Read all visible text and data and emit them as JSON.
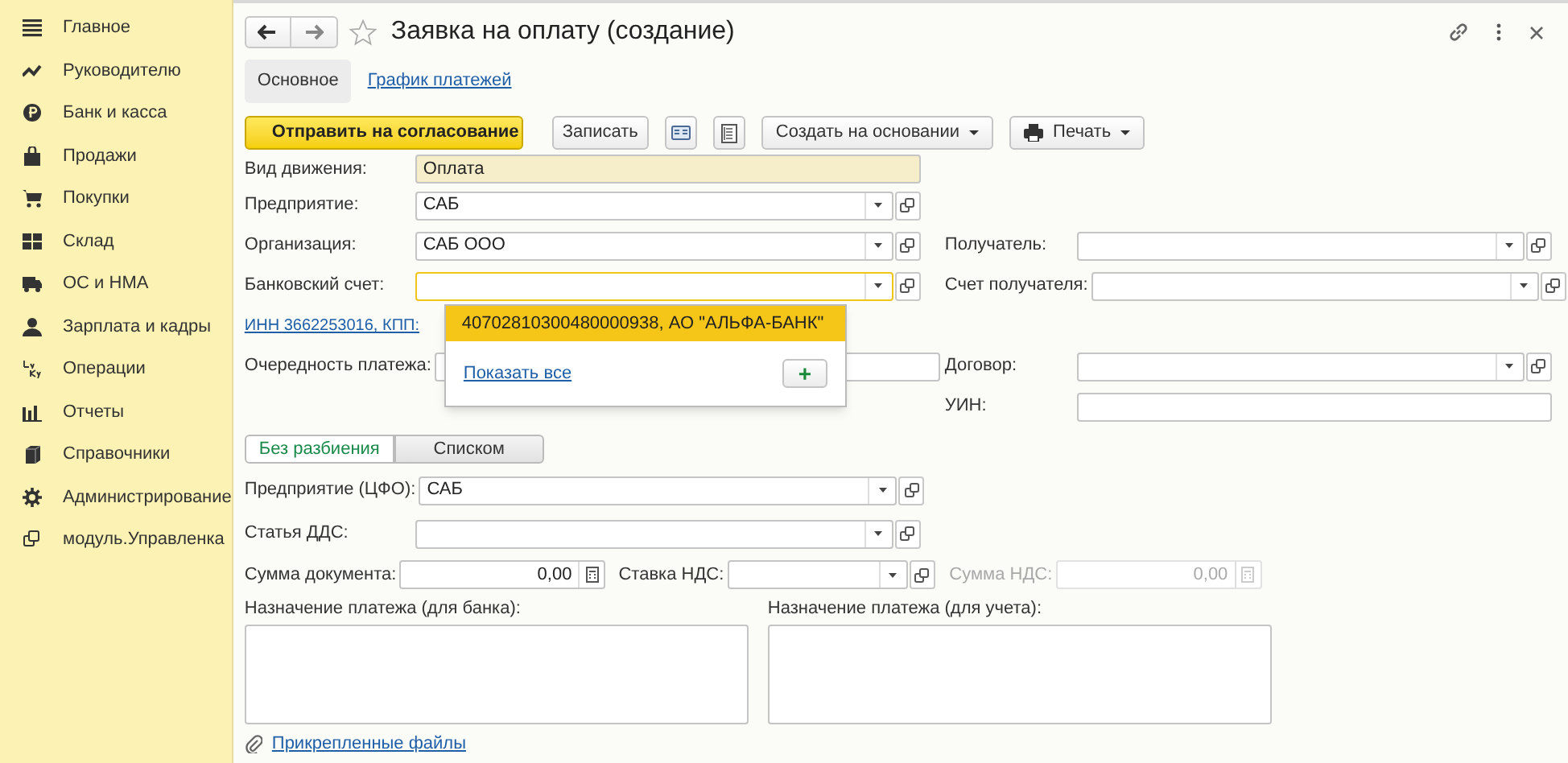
{
  "sidebar": {
    "items": [
      {
        "label": "Главное"
      },
      {
        "label": "Руководителю"
      },
      {
        "label": "Банк и касса"
      },
      {
        "label": "Продажи"
      },
      {
        "label": "Покупки"
      },
      {
        "label": "Склад"
      },
      {
        "label": "ОС и НМА"
      },
      {
        "label": "Зарплата и кадры"
      },
      {
        "label": "Операции"
      },
      {
        "label": "Отчеты"
      },
      {
        "label": "Справочники"
      },
      {
        "label": "Администрирование"
      },
      {
        "label": "модуль.Управленка"
      }
    ]
  },
  "window": {
    "title": "Заявка на оплату (создание)"
  },
  "tabs": [
    {
      "label": "Основное",
      "selected": true
    },
    {
      "label": "График платежей",
      "selected": false
    }
  ],
  "toolbar": {
    "primary": "Отправить на согласование",
    "buttons": [
      {
        "label": "Записать",
        "dropdown": false
      },
      {
        "label": "Создать на основании",
        "dropdown": true
      },
      {
        "label": "Печать",
        "dropdown": true
      }
    ]
  },
  "header_rows": [
    {
      "left": {
        "kind": "field",
        "label": "Вид движения:",
        "value": "Оплата",
        "readonly": true,
        "focused": false,
        "dropdown": false,
        "open": false
      }
    },
    {
      "left": {
        "kind": "field",
        "label": "Предприятие:",
        "value": "САБ",
        "readonly": false,
        "focused": false,
        "dropdown": true,
        "open": true
      }
    },
    {
      "left": {
        "kind": "field",
        "label": "Организация:",
        "value": "САБ ООО",
        "readonly": false,
        "focused": false,
        "dropdown": true,
        "open": true
      },
      "right": {
        "label": "Получатель:",
        "dropdown": true,
        "open": true
      }
    },
    {
      "left": {
        "kind": "field",
        "label": "Банковский счет:",
        "readonly": false,
        "focused": true,
        "dropdown": true,
        "open": true
      },
      "right": {
        "label": "Счет получателя:",
        "dropdown": true,
        "open": true
      }
    },
    {
      "left": {
        "kind": "link",
        "label": "ИНН 3662253016, КПП:"
      }
    },
    {
      "left": {
        "kind": "field",
        "label": "Очередность платежа:",
        "readonly": false,
        "focused": false,
        "dropdown": false,
        "open": false
      },
      "right": {
        "label": "Договор:",
        "dropdown": true,
        "open": true
      }
    },
    {
      "right": {
        "label": "УИН:",
        "dropdown": false,
        "open": false
      }
    }
  ],
  "popup": {
    "items": [
      {
        "label": "40702810300480000938, АО \"АЛЬФА-БАНК\"",
        "selected": true
      }
    ],
    "show_all": "Показать все",
    "add": "+"
  },
  "split_mode": [
    {
      "label": "Без разбиения",
      "selected": true
    },
    {
      "label": "Списком",
      "selected": false
    }
  ],
  "detail_rows": [
    {
      "label": "Предприятие (ЦФО):",
      "value": "САБ"
    },
    {
      "label": "Статья ДДС:"
    }
  ],
  "amount_row": [
    {
      "kind": "number",
      "label": "Сумма документа:",
      "value": "0,00",
      "disabled": false
    },
    {
      "kind": "select",
      "label": "Ставка НДС:",
      "disabled": false
    },
    {
      "kind": "number",
      "label": "Сумма НДС:",
      "value": "0,00",
      "disabled": true
    }
  ],
  "purpose": [
    {
      "label": "Назначение платежа (для банка):"
    },
    {
      "label": "Назначение платежа (для учета):"
    }
  ],
  "attachments": "Прикрепленные файлы"
}
